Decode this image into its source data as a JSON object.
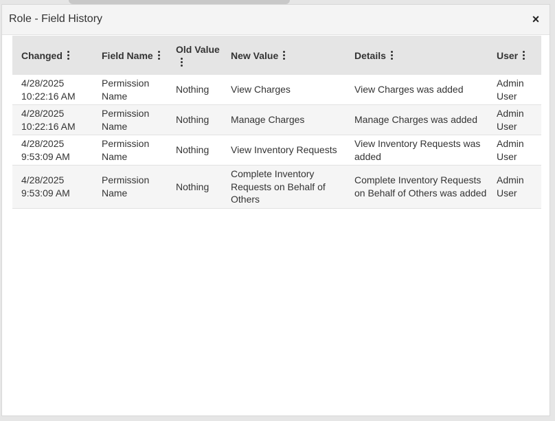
{
  "dialog": {
    "title": "Role - Field History",
    "close_label": "×"
  },
  "table": {
    "headers": {
      "changed": "Changed",
      "field_name": "Field Name",
      "old_value": "Old Value",
      "new_value": "New Value",
      "details": "Details",
      "user": "User"
    },
    "rows": [
      {
        "changed_date": "4/28/2025",
        "changed_time": "10:22:16 AM",
        "field_name_1": "Permission",
        "field_name_2": "Name",
        "old_value": "Nothing",
        "new_value": "View Charges",
        "details": "View Charges was added",
        "user_1": "Admin",
        "user_2": "User"
      },
      {
        "changed_date": "4/28/2025",
        "changed_time": "10:22:16 AM",
        "field_name_1": "Permission",
        "field_name_2": "Name",
        "old_value": "Nothing",
        "new_value": "Manage Charges",
        "details": "Manage Charges was added",
        "user_1": "Admin",
        "user_2": "User"
      },
      {
        "changed_date": "4/28/2025",
        "changed_time": "9:53:09 AM",
        "field_name_1": "Permission",
        "field_name_2": "Name",
        "old_value": "Nothing",
        "new_value": "View Inventory Requests",
        "details": "View Inventory Requests was added",
        "user_1": "Admin",
        "user_2": "User"
      },
      {
        "changed_date": "4/28/2025",
        "changed_time": "9:53:09 AM",
        "field_name_1": "Permission",
        "field_name_2": "Name",
        "old_value": "Nothing",
        "new_value": "Complete Inventory Requests on Behalf of Others",
        "details": "Complete Inventory Requests on Behalf of Others was added",
        "user_1": "Admin",
        "user_2": "User"
      }
    ]
  },
  "icons": {
    "column_menu": "kebab-menu-icon",
    "close": "close-icon"
  },
  "colors": {
    "header_bg": "#e5e5e5",
    "title_bar_bg": "#f4f4f4",
    "stripe_bg": "#f5f5f5",
    "text": "#333333"
  }
}
